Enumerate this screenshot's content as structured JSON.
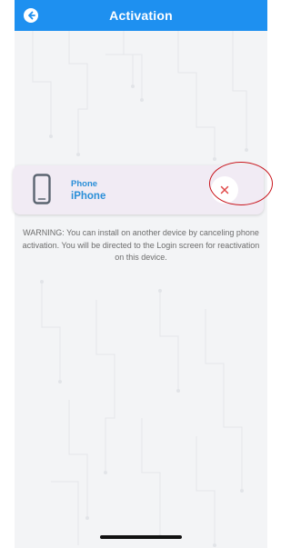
{
  "header": {
    "title": "Activation",
    "back_icon": "arrow-left-circle-icon"
  },
  "device_card": {
    "icon": "smartphone-icon",
    "type_label": "Phone",
    "device_name": "iPhone",
    "remove_icon": "close-icon"
  },
  "warning_text": "WARNING: You can install on another device by canceling phone activation. You will be directed to the Login screen for reactivation on this device.",
  "colors": {
    "header_bg": "#1e90f0",
    "accent_text": "#2b8fd8",
    "remove_icon": "#e04a4a",
    "highlight_ring": "#c8141c"
  }
}
